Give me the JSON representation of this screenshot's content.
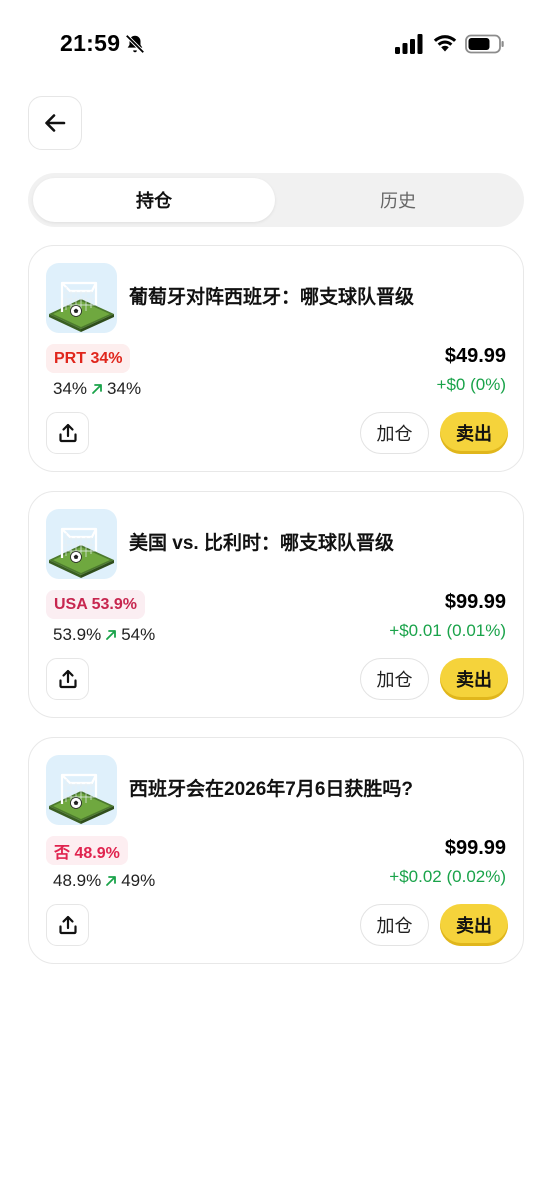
{
  "status_bar": {
    "time": "21:59"
  },
  "tabs": [
    {
      "label": "持仓",
      "active": true
    },
    {
      "label": "历史",
      "active": false
    }
  ],
  "positions": [
    {
      "title": "葡萄牙对阵西班牙：哪支球队晋级",
      "badge": "PRT 34%",
      "badge_color": "#e0261c",
      "badge_bg": "#fdeeee",
      "prob_from": "34%",
      "prob_to": "34%",
      "value": "$49.99",
      "pnl": "+$0 (0%)",
      "add_label": "加仓",
      "sell_label": "卖出"
    },
    {
      "title": "美国 vs. 比利时：哪支球队晋级",
      "badge": "USA 53.9%",
      "badge_color": "#c7264f",
      "badge_bg": "#fbeef2",
      "prob_from": "53.9%",
      "prob_to": "54%",
      "value": "$99.99",
      "pnl": "+$0.01 (0.01%)",
      "add_label": "加仓",
      "sell_label": "卖出"
    },
    {
      "title": "西班牙会在2026年7月6日获胜吗?",
      "badge": "否 48.9%",
      "badge_color": "#e0234e",
      "badge_bg": "#fdeef1",
      "prob_from": "48.9%",
      "prob_to": "49%",
      "value": "$99.99",
      "pnl": "+$0.02 (0.02%)",
      "add_label": "加仓",
      "sell_label": "卖出"
    }
  ],
  "colors": {
    "accent_yellow": "#f5d33b",
    "positive_green": "#1aa34a"
  },
  "icons": [
    "bell-slash-icon",
    "signal-icon",
    "wifi-icon",
    "battery-icon",
    "back-arrow-icon",
    "soccer-goal-icon",
    "trend-up-icon",
    "share-icon"
  ]
}
